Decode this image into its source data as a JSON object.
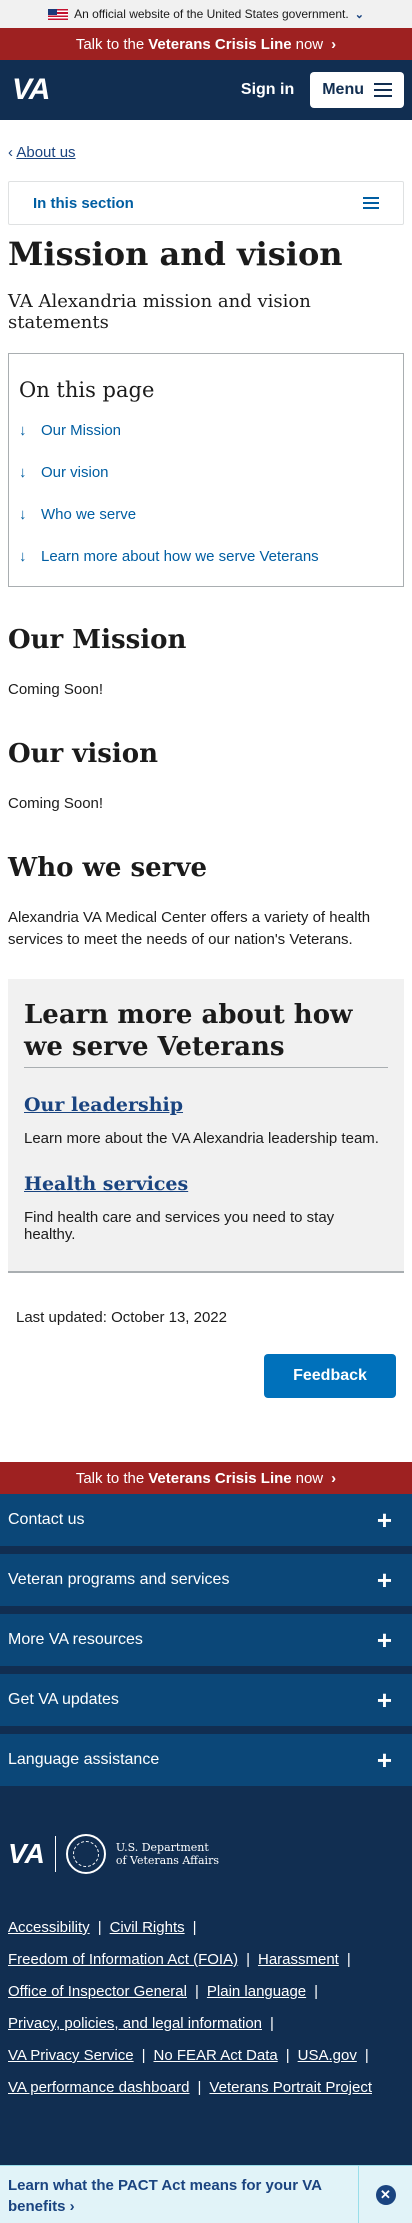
{
  "gov_banner": {
    "text": "An official website of the United States government.",
    "toggle_icon": "chevron-down-icon"
  },
  "crisis_line": {
    "prefix": "Talk to the",
    "bold": "Veterans Crisis Line",
    "suffix": "now",
    "arrow": "›"
  },
  "header": {
    "logo": "VA",
    "sign_in": "Sign in",
    "menu": "Menu"
  },
  "breadcrumb": {
    "back_label": "About us"
  },
  "in_this_section": "In this section",
  "page": {
    "title": "Mission and vision",
    "lead": "VA Alexandria mission and vision statements"
  },
  "on_this_page": {
    "heading": "On this page",
    "items": [
      {
        "label": "Our Mission"
      },
      {
        "label": "Our vision"
      },
      {
        "label": "Who we serve"
      },
      {
        "label": "Learn more about how we serve Veterans"
      }
    ]
  },
  "sections": {
    "mission": {
      "heading": "Our Mission",
      "text": "Coming Soon!"
    },
    "vision": {
      "heading": "Our vision",
      "text": "Coming Soon!"
    },
    "serve": {
      "heading": "Who we serve",
      "text": "Alexandria VA Medical Center offers a variety of health services to meet the needs of our nation's Veterans."
    }
  },
  "learn_more": {
    "heading": "Learn more about how we serve Veterans",
    "links": [
      {
        "title": "Our leadership",
        "desc": "Learn more about the VA Alexandria leadership team."
      },
      {
        "title": "Health services",
        "desc": "Find health care and services you need to stay healthy."
      }
    ]
  },
  "last_updated": "Last updated: October 13, 2022",
  "feedback": "Feedback",
  "footer": {
    "accordion": [
      {
        "label": "Contact us"
      },
      {
        "label": "Veteran programs and services"
      },
      {
        "label": "More VA resources"
      },
      {
        "label": "Get VA updates"
      },
      {
        "label": "Language assistance"
      }
    ],
    "logo": "VA",
    "dept_line1": "U.S. Department",
    "dept_line2": "of Veterans Affairs",
    "links": [
      [
        "Accessibility",
        "Civil Rights"
      ],
      [
        "Freedom of Information Act (FOIA)",
        "Harassment"
      ],
      [
        "Office of Inspector General",
        "Plain language"
      ],
      [
        "Privacy, policies, and legal information"
      ],
      [
        "VA Privacy Service",
        "No FEAR Act Data",
        "USA.gov"
      ],
      [
        "VA performance dashboard",
        "Veterans Portrait Project"
      ]
    ]
  },
  "pact_banner": {
    "text": "Learn what the PACT Act means for your VA benefits ›",
    "close_icon": "close-icon"
  }
}
